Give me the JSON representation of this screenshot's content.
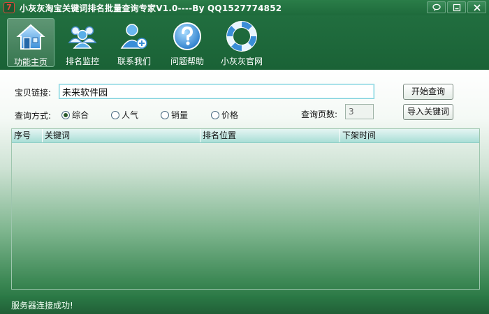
{
  "window": {
    "title": "小灰灰淘宝关键词排名批量查询专家V1.0----By QQ1527774852",
    "app_icon_glyph": "7"
  },
  "toolbar": {
    "items": [
      {
        "label": "功能主页",
        "icon": "home-icon",
        "active": true
      },
      {
        "label": "排名监控",
        "icon": "users-icon",
        "active": false
      },
      {
        "label": "联系我们",
        "icon": "contact-icon",
        "active": false
      },
      {
        "label": "问题帮助",
        "icon": "help-icon",
        "active": false
      },
      {
        "label": "小灰灰官网",
        "icon": "lifebuoy-icon",
        "active": false
      }
    ]
  },
  "form": {
    "url_label": "宝贝链接:",
    "url_value": "未来软件园",
    "mode_label": "查询方式:",
    "modes": [
      {
        "label": "综合",
        "selected": true
      },
      {
        "label": "人气",
        "selected": false
      },
      {
        "label": "销量",
        "selected": false
      },
      {
        "label": "价格",
        "selected": false
      }
    ],
    "pages_label": "查询页数:",
    "pages_value": "3",
    "start_button": "开始查询",
    "import_button": "导入关键词"
  },
  "table": {
    "columns": [
      "序号",
      "关键词",
      "排名位置",
      "下架时间"
    ],
    "rows": []
  },
  "status": {
    "text": "服务器连接成功!"
  },
  "colors": {
    "primary_green": "#1d6b3a",
    "header_teal": "#a9ded6",
    "input_border": "#7fd0dc"
  }
}
